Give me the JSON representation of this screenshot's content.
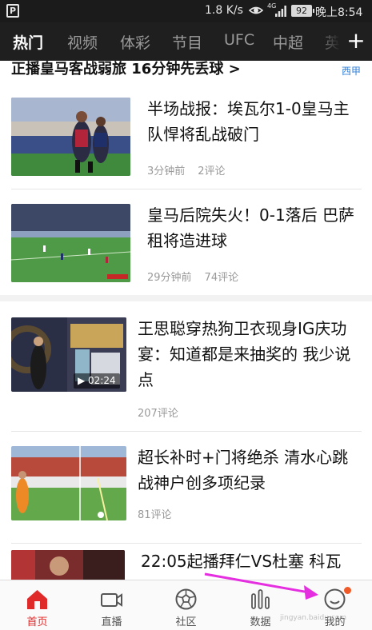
{
  "status_bar": {
    "app_icon": "P",
    "network_speed": "1.8 K/s",
    "signal_label": "4G",
    "battery": "92",
    "time": "晚上8:54"
  },
  "tabs": [
    {
      "label": "热门",
      "active": true
    },
    {
      "label": "视频",
      "active": false
    },
    {
      "label": "体彩",
      "active": false
    },
    {
      "label": "节目",
      "active": false
    },
    {
      "label": "UFC",
      "active": false
    },
    {
      "label": "中超",
      "active": false
    },
    {
      "label": "英",
      "active": false
    }
  ],
  "tabs_plus": "+",
  "headline": {
    "text": "正播皇马客战弱旅 16分钟先丢球 >",
    "tag": "西甲"
  },
  "news": [
    {
      "title": "半场战报：埃瓦尔1-0皇马主队悍将乱战破门",
      "time": "3分钟前",
      "comments": "2评论"
    },
    {
      "title": "皇马后院失火！0-1落后 巴萨租将造进球",
      "time": "29分钟前",
      "comments": "74评论"
    },
    {
      "title": "王思聪穿热狗卫衣现身IG庆功宴：知道都是来抽奖的 我少说点",
      "comments": "207评论",
      "duration": "▶ 02:24"
    },
    {
      "title": "超长补时+门将绝杀 清水心跳战神户创多项纪录",
      "comments": "81评论"
    },
    {
      "title": "22:05起播拜仁VS杜塞 科瓦"
    }
  ],
  "bottom_nav": [
    {
      "label": "首页",
      "icon": "home-icon",
      "active": true
    },
    {
      "label": "直播",
      "icon": "video-camera-icon",
      "active": false
    },
    {
      "label": "社区",
      "icon": "soccer-ball-icon",
      "active": false
    },
    {
      "label": "数据",
      "icon": "bar-stats-icon",
      "active": false
    },
    {
      "label": "我的",
      "icon": "profile-icon",
      "active": false,
      "badge": true
    }
  ],
  "colors": {
    "accent_red": "#e02a2a",
    "tag_blue": "#2f7fd6",
    "annotation_arrow": "#e52ee0",
    "notification_dot": "#f05a28"
  },
  "watermark": "jingyan.baidu.com"
}
